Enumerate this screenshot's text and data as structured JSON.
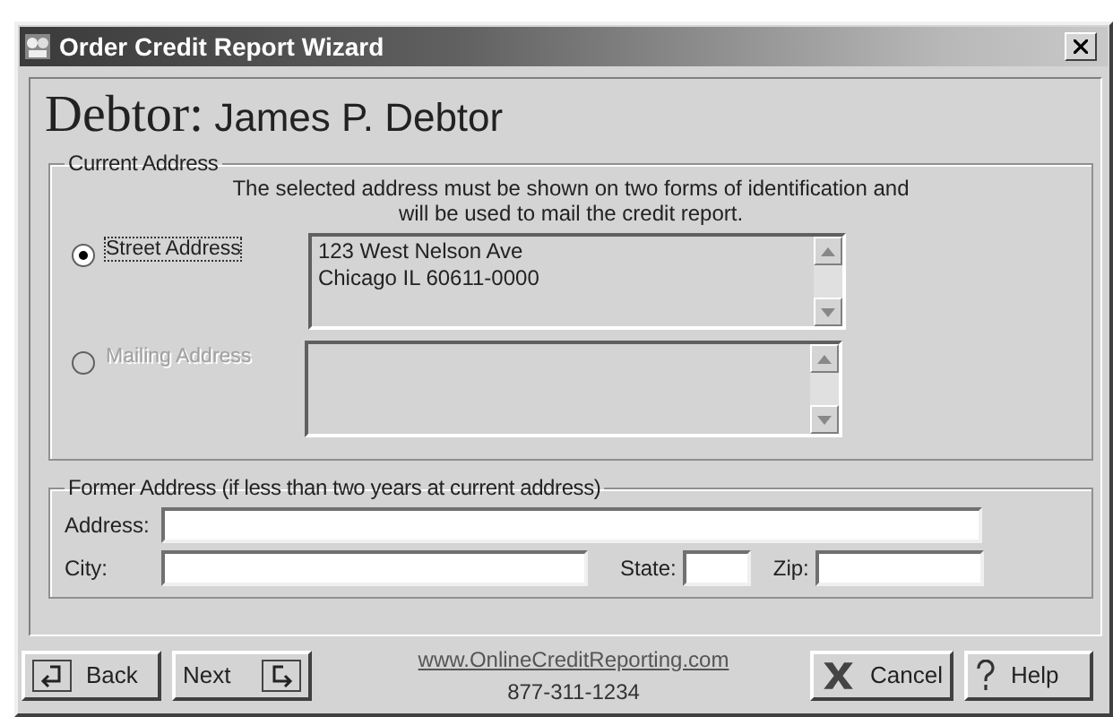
{
  "window": {
    "title": "Order Credit Report Wizard"
  },
  "heading": {
    "label": "Debtor:",
    "name": "James P. Debtor"
  },
  "current_address": {
    "legend": "Current Address",
    "note": "The selected address must be shown on two forms of identification and will be used to mail the credit report.",
    "options": [
      {
        "label": "Street Address",
        "selected": true,
        "disabled": false,
        "lines": [
          "123 West Nelson Ave",
          "Chicago IL 60611-0000"
        ]
      },
      {
        "label": "Mailing Address",
        "selected": false,
        "disabled": true
      }
    ]
  },
  "former_address": {
    "legend": "Former Address (if less than two years at current address)",
    "address_label": "Address:",
    "city_label": "City:",
    "state_label": "State:",
    "zip_label": "Zip:"
  },
  "footer": {
    "back": "Back",
    "next": "Next",
    "link": "www.OnlineCreditReporting.com",
    "phone": "877-311-1234",
    "cancel": "Cancel",
    "help": "Help"
  }
}
